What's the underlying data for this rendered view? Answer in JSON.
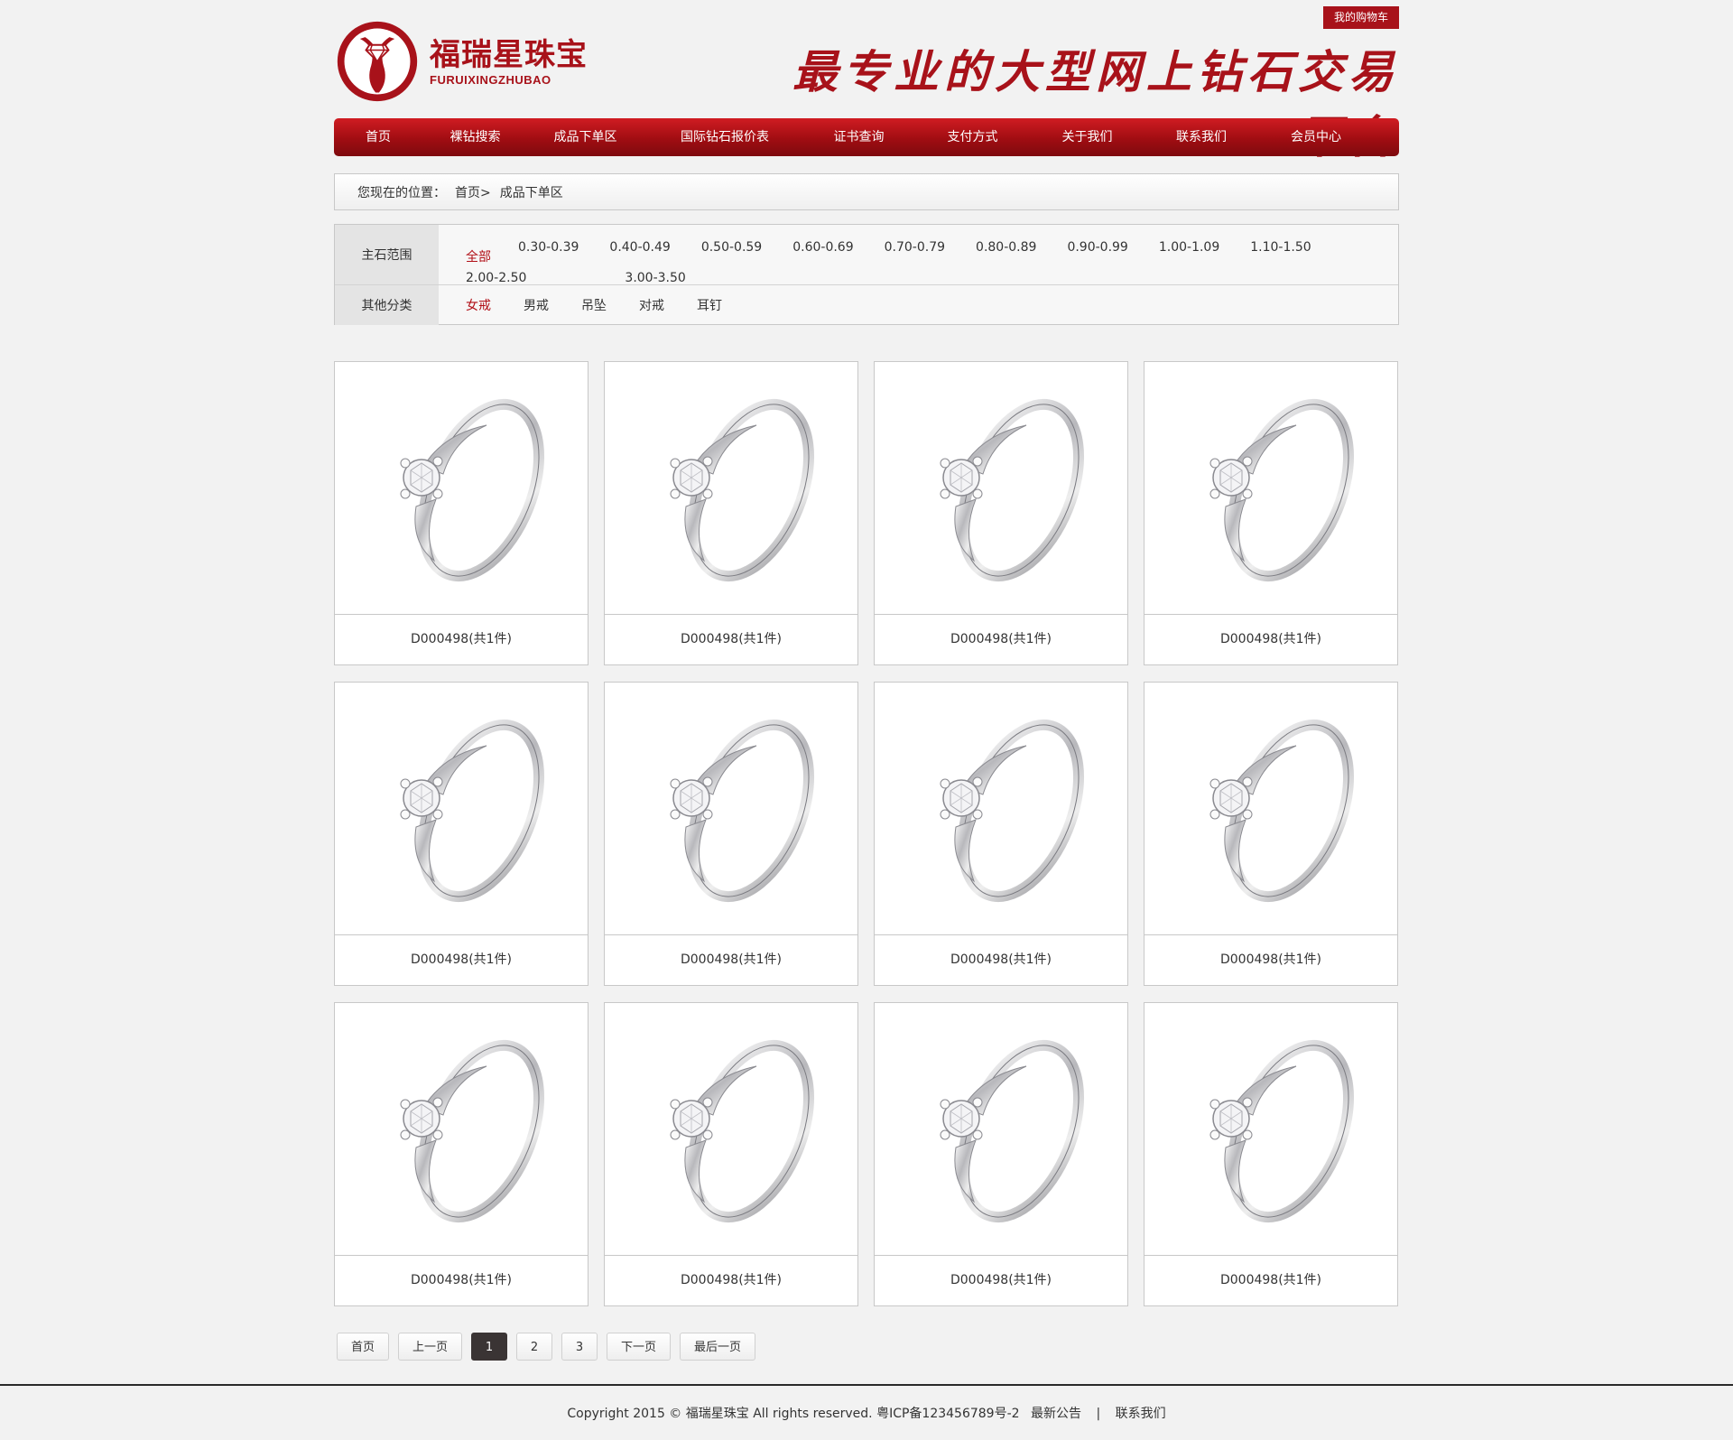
{
  "header": {
    "cart_label": "我的购物车",
    "logo_cn": "福瑞星珠宝",
    "logo_en": "FURUIXINGZHUBAO",
    "slogan": "最专业的大型网上钻石交易平台",
    "brand_color": "#a8121a"
  },
  "nav": {
    "items": [
      "首页",
      "裸钻搜索",
      "成品下单区",
      "国际钻石报价表",
      "证书查询",
      "支付方式",
      "关于我们",
      "联系我们",
      "会员中心"
    ]
  },
  "breadcrumb": {
    "label": "您现在的位置：",
    "home": "首页>",
    "current": "成品下单区"
  },
  "filter": {
    "stone_label": "主石范围",
    "stone_options": [
      "全部",
      "0.30-0.39",
      "0.40-0.49",
      "0.50-0.59",
      "0.60-0.69",
      "0.70-0.79",
      "0.80-0.89",
      "0.90-0.99",
      "1.00-1.09",
      "1.10-1.50",
      "2.00-2.50",
      "3.00-3.50"
    ],
    "stone_selected": "全部",
    "other_label": "其他分类",
    "other_options": [
      "女戒",
      "男戒",
      "吊坠",
      "对戒",
      "耳钉"
    ],
    "other_selected": "女戒"
  },
  "products": [
    {
      "title": "D000498(共1件)"
    },
    {
      "title": "D000498(共1件)"
    },
    {
      "title": "D000498(共1件)"
    },
    {
      "title": "D000498(共1件)"
    },
    {
      "title": "D000498(共1件)"
    },
    {
      "title": "D000498(共1件)"
    },
    {
      "title": "D000498(共1件)"
    },
    {
      "title": "D000498(共1件)"
    },
    {
      "title": "D000498(共1件)"
    },
    {
      "title": "D000498(共1件)"
    },
    {
      "title": "D000498(共1件)"
    },
    {
      "title": "D000498(共1件)"
    }
  ],
  "pagination": {
    "first": "首页",
    "prev": "上一页",
    "pages": [
      "1",
      "2",
      "3"
    ],
    "current": "1",
    "next": "下一页",
    "last": "最后一页"
  },
  "footer": {
    "copyright": "Copyright 2015 © 福瑞星珠宝 All rights reserved. 粤ICP备123456789号-2",
    "notice": "最新公告",
    "sep": "|",
    "contact": "联系我们"
  }
}
